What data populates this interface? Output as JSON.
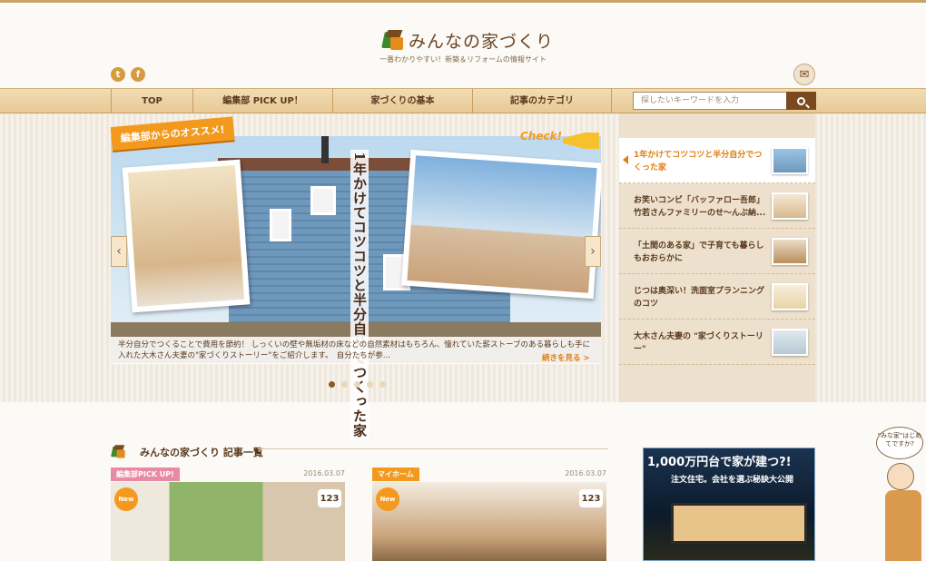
{
  "header": {
    "logo_text": "みんなの家づくり",
    "tagline": "一番わかりやすい！新築＆リフォームの情報サイト",
    "social": [
      "t",
      "f"
    ]
  },
  "nav": {
    "items": [
      "TOP",
      "編集部 PICK UP！",
      "家づくりの基本",
      "記事のカテゴリ"
    ],
    "search_placeholder": "探したいキーワードを入力"
  },
  "hero": {
    "ribbon": "編集部からのオススメ!",
    "check": "Check!",
    "headline": "1年かけてコツコツと半分自分でつくった家",
    "caption": "半分自分でつくることで費用を節約！ しっくいの壁や無垢材の床などの自然素材はもちろん、憧れていた薪ストーブのある暮らしも手に入れた大木さん夫妻の\"家づくりストーリー\"をご紹介します。　自分たちが参...",
    "more": "続きを見る >",
    "prev": "‹",
    "next": "›"
  },
  "sidebar": {
    "items": [
      {
        "title": "1年かけてコツコツと半分自分でつくった家",
        "active": true
      },
      {
        "title": "お笑いコンビ「バッファロー吾郎」竹若さんファミリーのせ〜んぶ納..."
      },
      {
        "title": "「土間のある家」で子育ても暮らしもおおらかに"
      },
      {
        "title": "じつは奥深い！洗面室プランニングのコツ"
      },
      {
        "title": "大木さん夫妻の \"家づくりストーリー\""
      }
    ]
  },
  "articles": {
    "section_title": "みんなの家づくり 記事一覧",
    "cards": [
      {
        "tag": "編集部PICK UP!",
        "tag_color": "#e889a8",
        "date": "2016.03.07",
        "badge": "New",
        "count": "123"
      },
      {
        "tag": "マイホーム",
        "tag_color": "#f39a1e",
        "date": "2016.03.07",
        "badge": "New",
        "count": "123"
      }
    ]
  },
  "ad": {
    "headline": "1,000万円台で家が建つ?!",
    "sub": "注文住宅。会社を選ぶ秘訣大公開"
  },
  "mascot": {
    "bubble": "\"みな家\"はじめてですか?"
  },
  "colors": {
    "brand_brown": "#7a4a1e",
    "accent_orange": "#f39a1e",
    "nav_wood": "#e7c995"
  }
}
